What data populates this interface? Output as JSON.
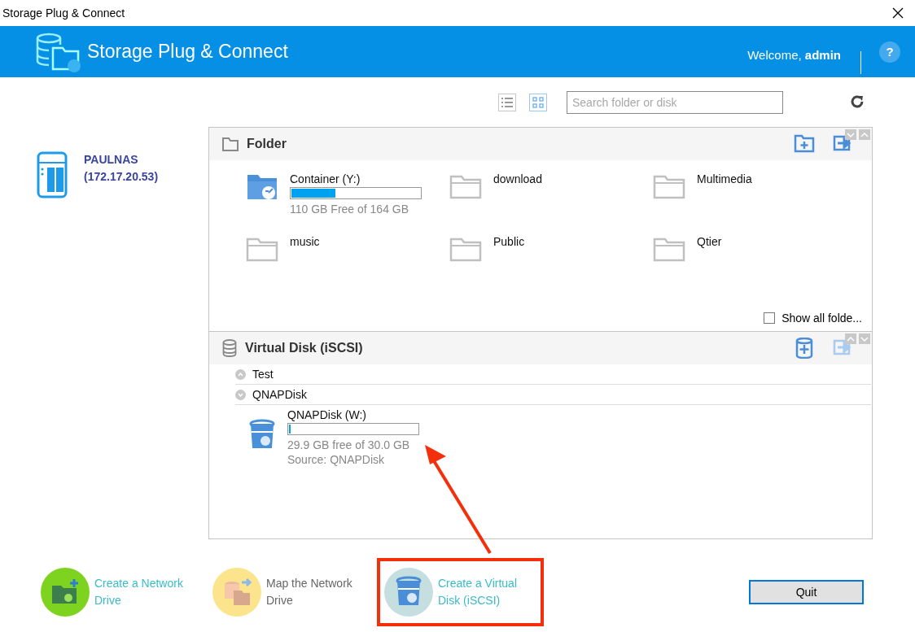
{
  "window": {
    "title": "Storage Plug & Connect"
  },
  "header": {
    "title": "Storage Plug & Connect",
    "welcome": "Welcome, **admin**",
    "help": "?"
  },
  "toolbar": {
    "views": [
      {
        "kind": "list",
        "selected": false
      },
      {
        "kind": "grid",
        "selected": true
      }
    ],
    "search": {
      "placeholder": "Search folder or disk"
    }
  },
  "device": {
    "name": "PAULNAS",
    "address": "(172.17.20.53)"
  },
  "folder_section": {
    "title": "Folder",
    "expanded": true,
    "items": [
      {
        "kind": "drive",
        "name": "Container (Y:)",
        "level": 0.34,
        "free": "110 GB Free of 164 GB"
      },
      {
        "kind": "folder",
        "name": "download"
      },
      {
        "kind": "folder",
        "name": "Multimedia"
      },
      {
        "kind": "folder",
        "name": "music"
      },
      {
        "kind": "folder",
        "name": "Public"
      },
      {
        "kind": "folder",
        "name": "Qtier"
      }
    ],
    "show_all": {
      "label": "Show all folde...",
      "checked": false
    }
  },
  "disk_section": {
    "title": "Virtual Disk (iSCSI)",
    "expanded": true,
    "map_disabled": true,
    "groups": [
      {
        "name": "Test",
        "expanded": false
      },
      {
        "name": "QNAPDisk",
        "expanded": true,
        "children": [
          {
            "name": "QNAPDisk (W:)",
            "level": 0.01,
            "free": "29.9 GB free of 30.0 GB",
            "source": "Source: QNAPDisk"
          }
        ]
      }
    ]
  },
  "actions": [
    {
      "kind": "create-drive",
      "label": "Create a Network Drive",
      "color": "#7ed321",
      "disabled": false,
      "highlighted": false
    },
    {
      "kind": "map-drive",
      "label": "Map the Network Drive",
      "color": "#fbe48c",
      "disabled": true,
      "highlighted": false
    },
    {
      "kind": "create-disk",
      "label": "Create a Virtual Disk (iSCSI)",
      "color": "#c5dfe0",
      "disabled": false,
      "highlighted": true
    }
  ],
  "quit": "Quit"
}
